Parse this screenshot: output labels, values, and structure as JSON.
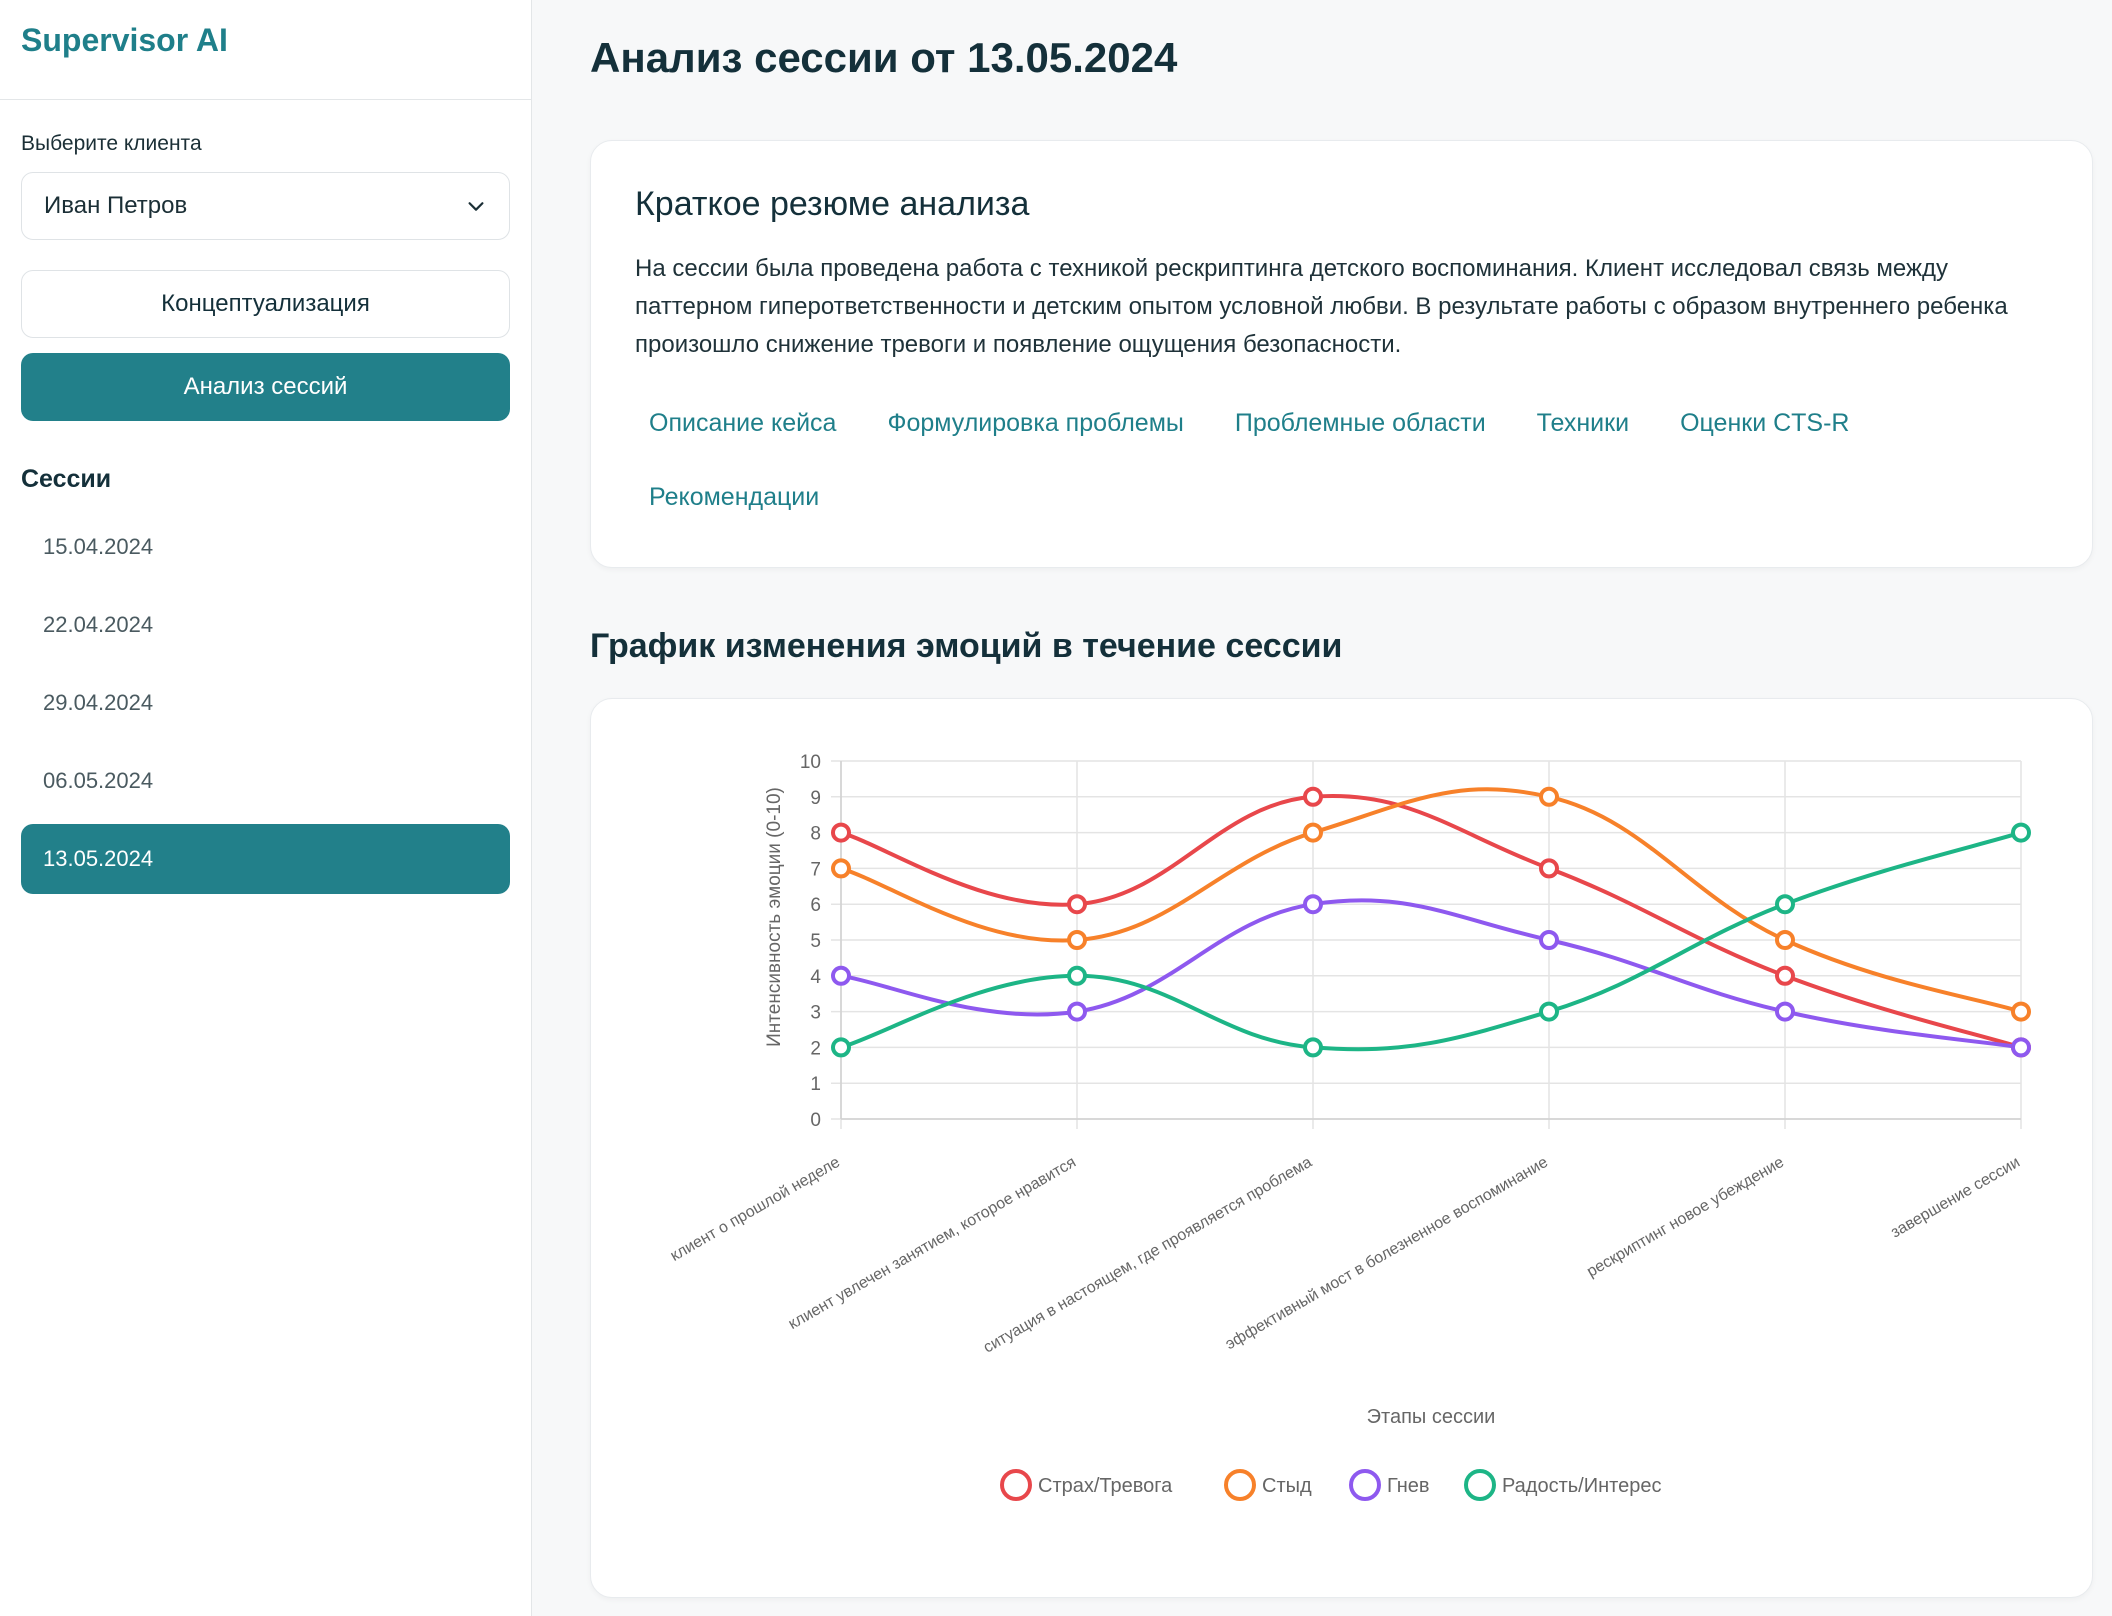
{
  "sidebar": {
    "brand": "Supervisor AI",
    "client_label": "Выберите клиента",
    "client_value": "Иван Петров",
    "buttons": {
      "conceptualization": "Концептуализация",
      "session_analysis": "Анализ сессий"
    },
    "sessions_title": "Сессии",
    "sessions": [
      "15.04.2024",
      "22.04.2024",
      "29.04.2024",
      "06.05.2024",
      "13.05.2024"
    ],
    "active_session_index": 4
  },
  "main": {
    "title": "Анализ сессии от 13.05.2024",
    "summary": {
      "title": "Краткое резюме анализа",
      "text": "На сессии была проведена работа с техникой рескриптинга детского воспоминания. Клиент исследовал связь между паттерном гиперответственности и детским опытом условной любви. В результате работы с образом внутреннего ребенка произошло снижение тревоги и появление ощущения безопасности.",
      "tabs": [
        "Описание кейса",
        "Формулировка проблемы",
        "Проблемные области",
        "Техники",
        "Оценки CTS-R",
        "Рекомендации"
      ]
    },
    "chart_section_title": "График изменения эмоций в течение сессии"
  },
  "colors": {
    "accent": "#22808a",
    "brand": "#1f7f8a"
  },
  "chart_data": {
    "type": "line",
    "title": "",
    "xlabel": "Этапы сессии",
    "ylabel": "Интенсивность эмоции (0-10)",
    "ylim": [
      0,
      10
    ],
    "yticks": [
      0,
      1,
      2,
      3,
      4,
      5,
      6,
      7,
      8,
      9,
      10
    ],
    "grid": true,
    "legend_position": "bottom",
    "categories": [
      "клиент о прошлой неделе",
      "клиент увлечен занятием, которое нравится",
      "ситуация в настоящем, где проявляется проблема",
      "эффективный мост в болезненное воспоминание",
      "рескриптинг новое убеждение",
      "завершение сессии"
    ],
    "series": [
      {
        "name": "Страх/Тревога",
        "color": "#e8474b",
        "values": [
          8,
          6,
          9,
          7,
          4,
          2
        ]
      },
      {
        "name": "Стыд",
        "color": "#f7812a",
        "values": [
          7,
          5,
          8,
          9,
          5,
          3
        ]
      },
      {
        "name": "Гнев",
        "color": "#8e59ef",
        "values": [
          4,
          3,
          6,
          5,
          3,
          2
        ]
      },
      {
        "name": "Радость/Интерес",
        "color": "#1db586",
        "values": [
          2,
          4,
          2,
          3,
          6,
          8
        ]
      }
    ]
  }
}
